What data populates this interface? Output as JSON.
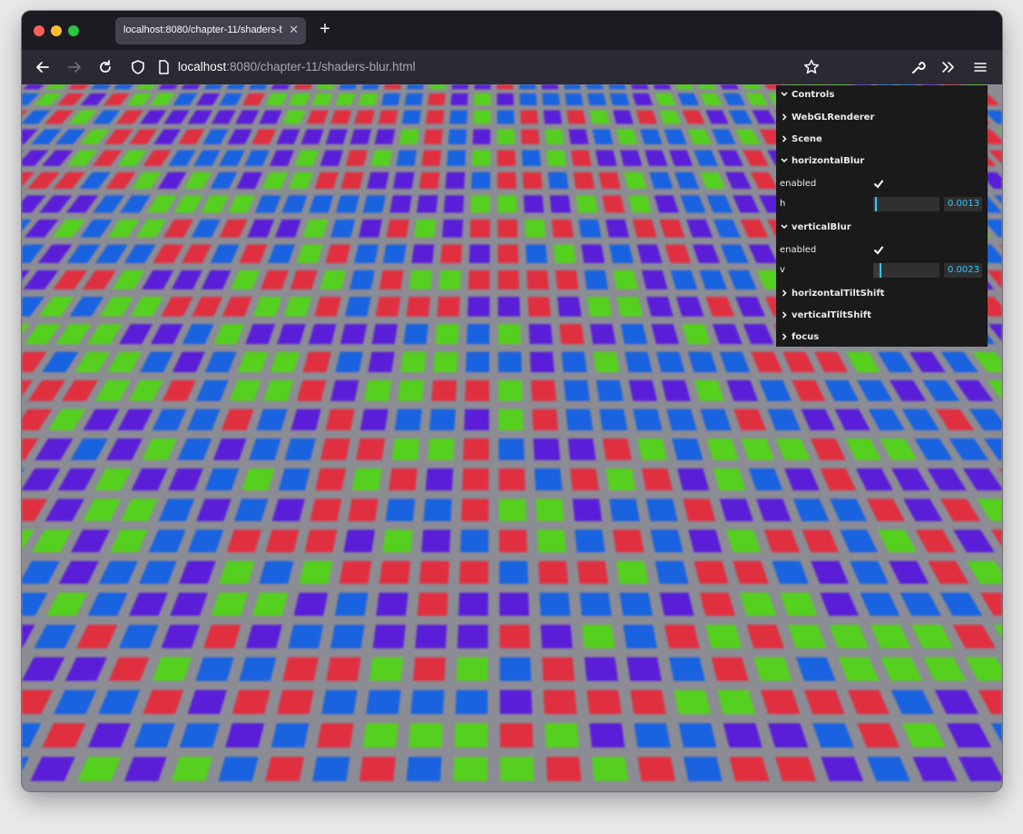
{
  "browser": {
    "tab_title": "localhost:8080/chapter-11/shaders-blur.html",
    "url_host": "localhost",
    "url_path": ":8080/chapter-11/shaders-blur.html"
  },
  "gui": {
    "folders": [
      {
        "label": "Controls",
        "expanded": true
      },
      {
        "label": "WebGLRenderer",
        "expanded": false
      },
      {
        "label": "Scene",
        "expanded": false
      },
      {
        "label": "horizontalBlur",
        "expanded": true
      },
      {
        "label": "verticalBlur",
        "expanded": true
      },
      {
        "label": "horizontalTiltShift",
        "expanded": false
      },
      {
        "label": "verticalTiltShift",
        "expanded": false
      },
      {
        "label": "focus",
        "expanded": false
      }
    ],
    "horizontalBlur": {
      "enabled_label": "enabled",
      "enabled": true,
      "h_label": "h",
      "h_value": "0.0013",
      "h_fraction": 0.05
    },
    "verticalBlur": {
      "enabled_label": "enabled",
      "enabled": true,
      "v_label": "v",
      "v_value": "0.0023",
      "v_fraction": 0.12
    }
  },
  "colors": {
    "block_red": "#e03040",
    "block_green": "#55d01e",
    "block_blue": "#1962e0",
    "block_purple": "#5a1ed8",
    "gui_accent": "#2cc9ff"
  }
}
